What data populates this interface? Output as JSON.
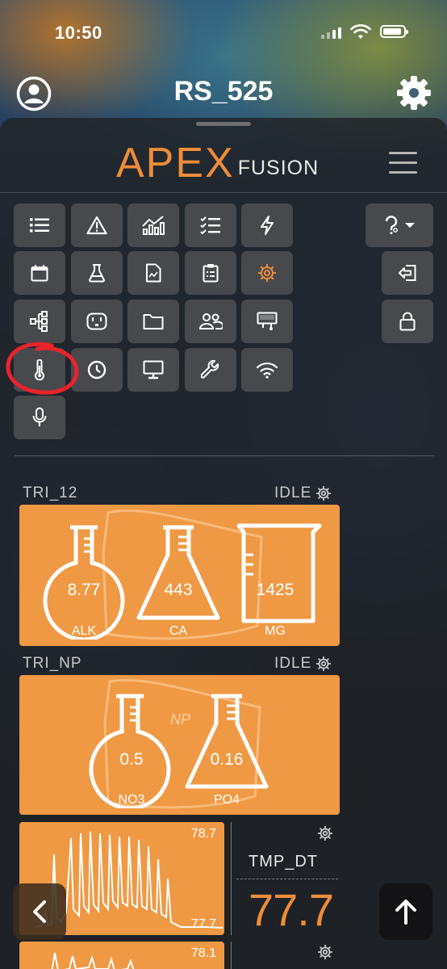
{
  "status_bar": {
    "time": "10:50"
  },
  "header": {
    "title": "RS_525"
  },
  "logo": {
    "apex": "APEX",
    "fusion": "FUSION"
  },
  "toolbar_icons": [
    "list-icon",
    "alert-triangle-icon",
    "chart-icon",
    "checklist-icon",
    "lightning-icon",
    "calendar-icon",
    "flask-icon",
    "document-icon",
    "clipboard-icon",
    "gear-icon",
    "flow-icon",
    "outlet-icon",
    "folder-icon",
    "users-icon",
    "display-module-icon",
    "thermometer-icon",
    "clock-icon",
    "monitor-icon",
    "wrench-icon",
    "wifi-icon",
    "microphone-icon",
    "help-icon",
    "logout-icon",
    "lock-icon"
  ],
  "trident1": {
    "name": "TRI_12",
    "status": "IDLE",
    "alk_value": "8.77",
    "alk_label": "ALK",
    "ca_value": "443",
    "ca_label": "CA",
    "mg_value": "1425",
    "mg_label": "MG"
  },
  "trident2": {
    "name": "TRI_NP",
    "status": "IDLE",
    "np_label": "NP",
    "no3_value": "0.5",
    "no3_label": "NO3",
    "po4_value": "0.16",
    "po4_label": "PO4"
  },
  "temp1": {
    "name": "TMP_DT",
    "value": "77.7",
    "graph_max": "78.7",
    "graph_min": "77.7"
  },
  "temp2": {
    "graph_max": "78.1"
  },
  "colors": {
    "accent": "#ee8c38",
    "card": "#ef9944",
    "panel": "#2a2c30",
    "button": "#47494d",
    "annotation": "#e8242a"
  }
}
